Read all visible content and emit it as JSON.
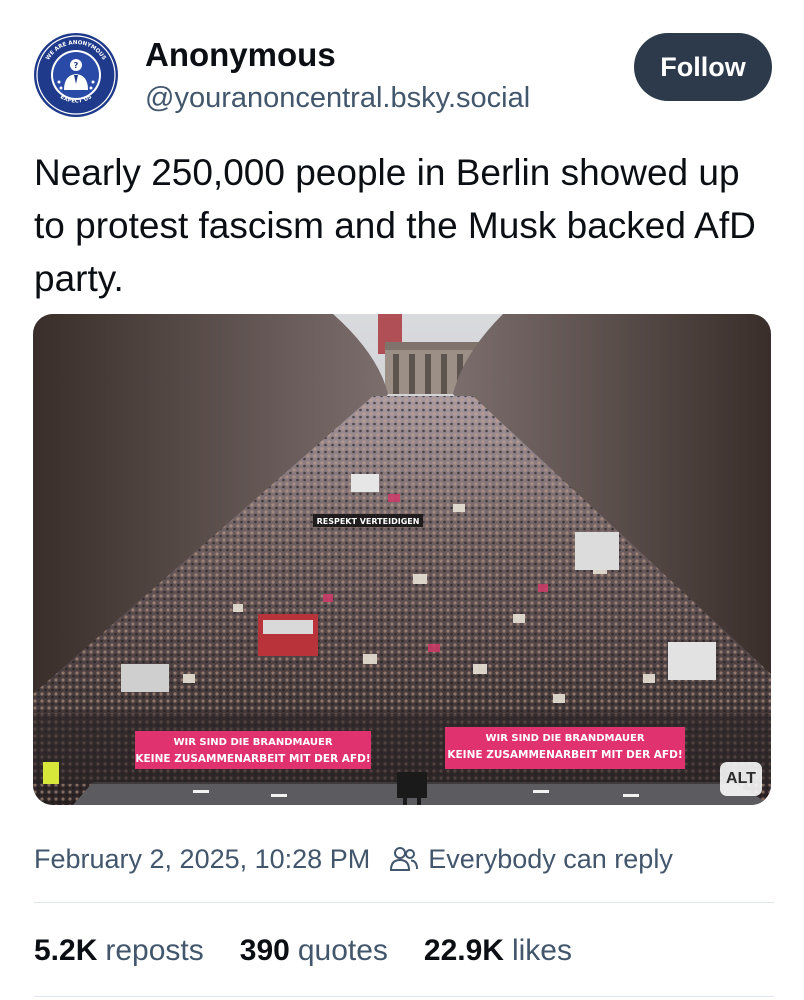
{
  "author": {
    "display_name": "Anonymous",
    "handle": "@youranoncentral.bsky.social",
    "avatar_text_top": "WE ARE ANONYMOUS",
    "avatar_text_bottom": "EXPECT US"
  },
  "actions": {
    "follow_label": "Follow"
  },
  "post": {
    "text": "Nearly 250,000 people in Berlin showed up to protest fascism and the Musk backed AfD party.",
    "media": {
      "alt_label": "ALT",
      "banner_left_line1": "WIR SIND DIE BRANDMAUER",
      "banner_left_line2": "KEINE ZUSAMMENARBEIT MIT DER AFD!",
      "banner_right_line1": "WIR SIND DIE BRANDMAUER",
      "banner_right_line2": "KEINE ZUSAMMENARBEIT MIT DER AFD!",
      "sign_text": "RESPEKT  VERTEIDIGEN"
    },
    "timestamp": "February 2, 2025, 10:28 PM",
    "reply_setting": "Everybody can reply"
  },
  "stats": {
    "reposts_count": "5.2K",
    "reposts_label": "reposts",
    "quotes_count": "390",
    "quotes_label": "quotes",
    "likes_count": "22.9K",
    "likes_label": "likes"
  },
  "colors": {
    "follow_bg": "#2c3a4b",
    "secondary_text": "#42566c",
    "banner_pink": "#e0326f"
  },
  "icons": {
    "reply_setting_icon": "people-icon"
  }
}
